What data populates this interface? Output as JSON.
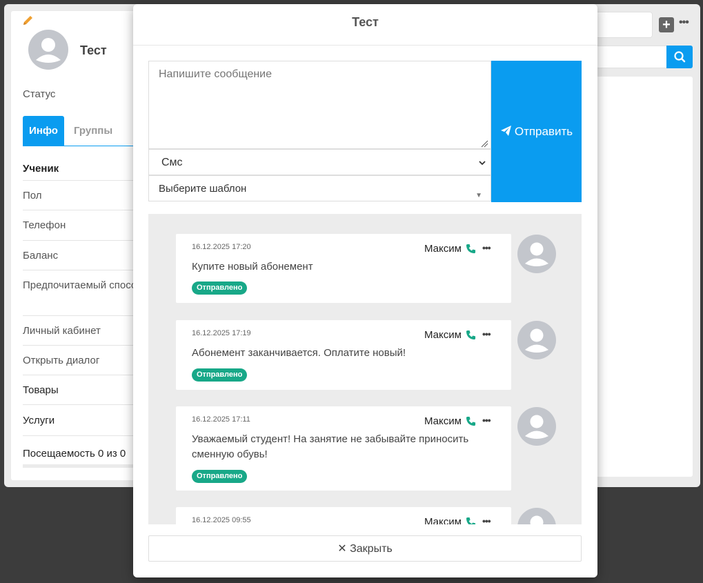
{
  "background": {
    "profile": {
      "name": "Тест",
      "status_label": "Статус",
      "tabs": [
        "Инфо",
        "Группы"
      ],
      "rows": [
        {
          "label": "Ученик",
          "style": "bold"
        },
        {
          "label": "Пол",
          "style": "normal"
        },
        {
          "label": "Телефон",
          "style": "normal"
        },
        {
          "label": "Баланс",
          "style": "normal"
        },
        {
          "label": "Предпочитаемый способ связи",
          "style": "normal"
        },
        {
          "label": "Личный кабинет",
          "style": "normal"
        },
        {
          "label": "Открыть диалог",
          "style": "normal"
        },
        {
          "label": "Товары",
          "style": "dark"
        },
        {
          "label": "Услуги",
          "style": "dark"
        },
        {
          "label": "Посещаемость 0 из 0",
          "style": "dark"
        }
      ]
    },
    "toolbar": {
      "plus_label": "+",
      "dots_label": "•••"
    }
  },
  "modal": {
    "title": "Тест",
    "message_placeholder": "Напишите сообщение",
    "channel_select": "Смс",
    "template_select": "Выберите шаблон",
    "send_label": "Отправить",
    "close_label": "Закрыть",
    "dots_label": "•••",
    "messages": [
      {
        "date": "16.12.2025 17:20",
        "author": "Максим",
        "text": "Купите новый абонемент",
        "status": "Отправлено"
      },
      {
        "date": "16.12.2025 17:19",
        "author": "Максим",
        "text": "Абонемент заканчивается. Оплатите новый!",
        "status": "Отправлено"
      },
      {
        "date": "16.12.2025 17:11",
        "author": "Максим",
        "text": "Уважаемый студент! На занятие не забывайте приносить сменную обувь!",
        "status": "Отправлено"
      },
      {
        "date": "16.12.2025 09:55",
        "author": "Максим",
        "text": "",
        "status": ""
      }
    ]
  },
  "colors": {
    "accent": "#0a9cf0",
    "badge": "#18a888",
    "phone": "#18a888",
    "edit": "#f0a030"
  },
  "icons": [
    "pencil-icon",
    "avatar-icon",
    "paper-plane-icon",
    "phone-icon",
    "close-x-icon",
    "search-icon",
    "plus-icon",
    "chevron-down-icon"
  ]
}
